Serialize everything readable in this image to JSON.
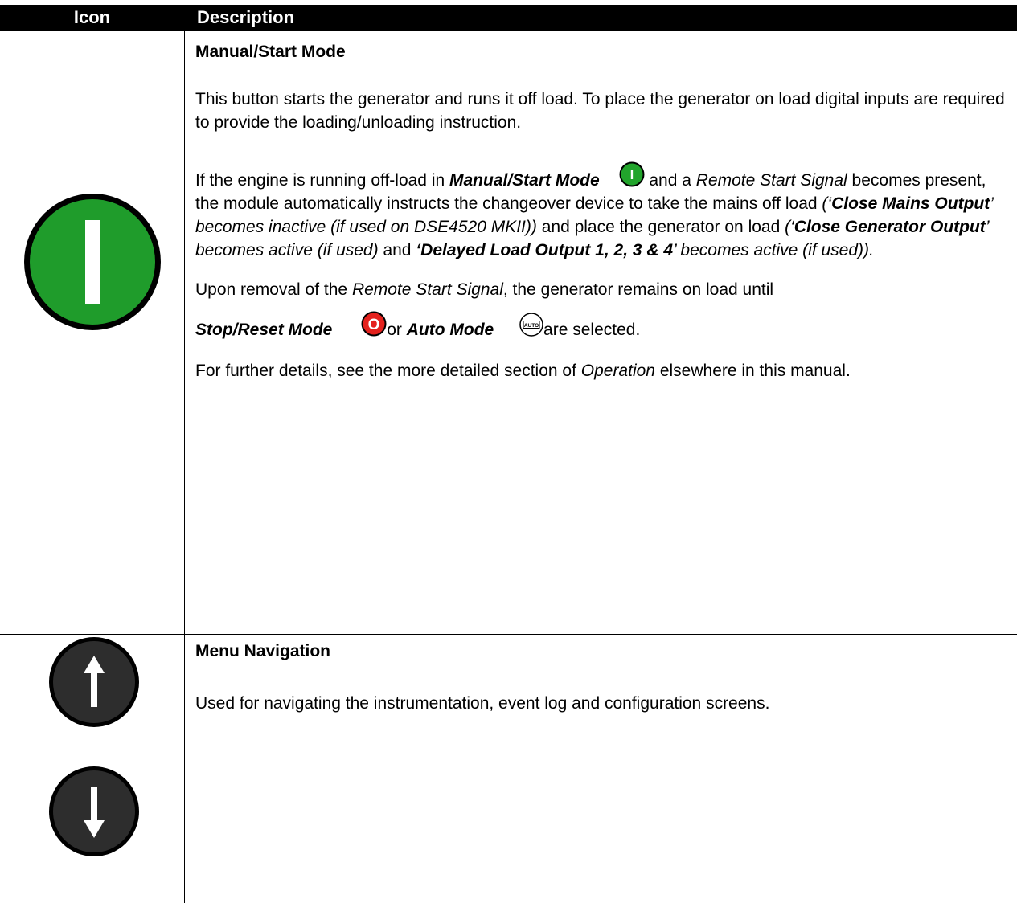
{
  "header": {
    "icon_col": "Icon",
    "desc_col": "Description"
  },
  "rows": [
    {
      "title": "Manual/Start Mode",
      "para1": "This button starts the generator and runs it off load. To place the generator on load digital inputs are required to provide the loading/unloading instruction.",
      "para2": {
        "t1": "If the engine is running off-load in ",
        "t2": "Manual/Start Mode",
        "t3": " and a ",
        "t4": "Remote Start Signal",
        "t5": " becomes present, the module automatically instructs the changeover device to take the mains off load ",
        "t6": "(‘",
        "t7": "Close Mains Output",
        "t8": "’ becomes inactive (if used on DSE4520 MKII))",
        "t9": " and place the generator on load ",
        "t10": "(‘",
        "t11": "Close Generator Output",
        "t12": "’ becomes active (if used)",
        "t13": " and ",
        "t14": "‘",
        "t15": "Delayed Load Output 1, 2, 3 & 4",
        "t16": "’ becomes active (if used))."
      },
      "para3": {
        "t1": "Upon removal of the ",
        "t2": "Remote Start Signal",
        "t3": ", the generator remains on load until",
        "t4": "Stop/Reset Mode",
        "t5": "or ",
        "t6": "Auto Mode",
        "t7": "are selected."
      },
      "para4": {
        "t1": "For further details, see the more detailed section of ",
        "t2": "Operation",
        "t3": " elsewhere in this manual."
      },
      "icon": "start-button-icon"
    },
    {
      "title": "Menu Navigation",
      "para1": "Used for navigating the instrumentation, event log and configuration screens.",
      "icons": [
        "up-arrow-button-icon",
        "down-arrow-button-icon"
      ]
    }
  ],
  "inline_icons": {
    "start_glyph": "I",
    "stop_glyph": "O",
    "auto_glyph": "AUTO"
  },
  "colors": {
    "start_green": "#1a9a2a",
    "stop_red": "#e0201e",
    "nav_dark": "#2b2b2b"
  }
}
